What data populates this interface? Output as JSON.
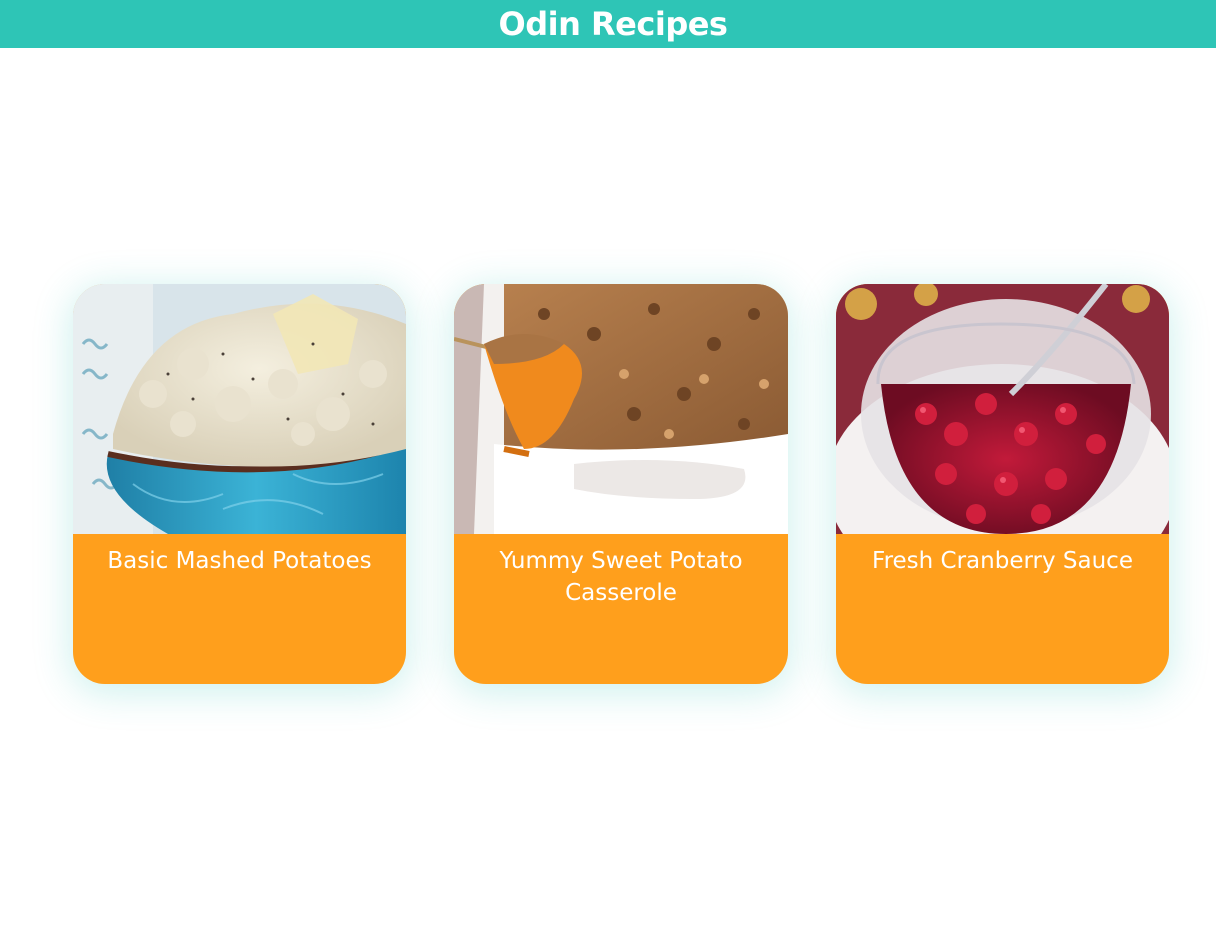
{
  "header": {
    "title": "Odin Recipes"
  },
  "colors": {
    "header_bg": "#2ec5b6",
    "card_bg": "#ff9f1c",
    "text": "#ffffff"
  },
  "recipes": [
    {
      "title": "Basic Mashed Potatoes",
      "image": "mashed-potatoes-photo"
    },
    {
      "title": "Yummy Sweet Potato Casserole",
      "image": "sweet-potato-casserole-photo"
    },
    {
      "title": "Fresh Cranberry Sauce",
      "image": "cranberry-sauce-photo"
    }
  ]
}
